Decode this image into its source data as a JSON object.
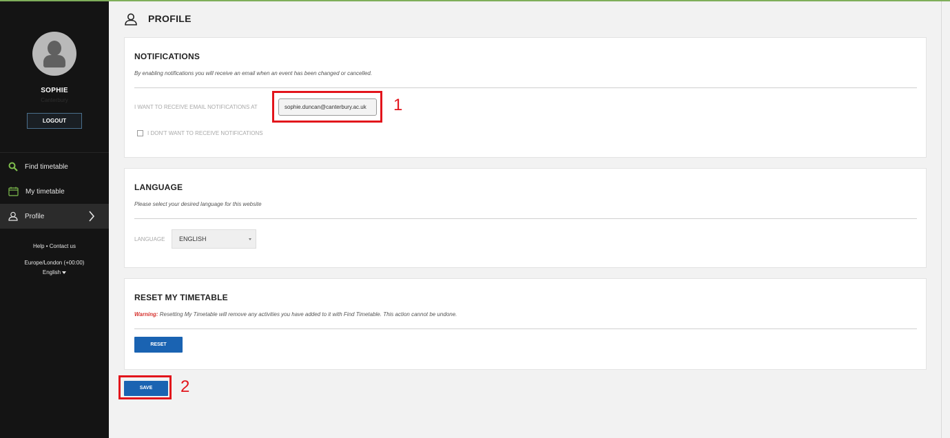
{
  "sidebar": {
    "user_name": "SOPHIE",
    "user_sub": "Canterbury",
    "logout_label": "LOGOUT",
    "nav": [
      {
        "label": "Find timetable",
        "icon": "search-icon"
      },
      {
        "label": "My timetable",
        "icon": "calendar-icon"
      },
      {
        "label": "Profile",
        "icon": "user-icon"
      }
    ],
    "help_label": "Help",
    "contact_label": "Contact us",
    "timezone": "Europe/London (+00:00)",
    "language": "English"
  },
  "page": {
    "title": "PROFILE"
  },
  "notifications": {
    "heading": "NOTIFICATIONS",
    "description": "By enabling notifications you will receive an email when an event has been changed or cancelled.",
    "email_label": "I WANT TO RECEIVE EMAIL NOTIFICATIONS AT",
    "email_value": "sophie.duncan@canterbury.ac.uk",
    "optout_label": "I DON'T WANT TO RECEIVE NOTIFICATIONS"
  },
  "language_section": {
    "heading": "LANGUAGE",
    "description": "Please select your desired language for this website",
    "label": "LANGUAGE",
    "selected": "ENGLISH"
  },
  "reset_section": {
    "heading": "RESET MY TIMETABLE",
    "warning_label": "Warning:",
    "warning_text": "Resetting My Timetable will remove any activities you have added to it with Find Timetable. This action cannot be undone.",
    "reset_label": "RESET"
  },
  "save_label": "SAVE",
  "annotations": {
    "one": "1",
    "two": "2"
  },
  "colors": {
    "accent_green": "#7fae5a",
    "button_blue": "#1a63b2",
    "annotation_red": "#e2141b"
  }
}
